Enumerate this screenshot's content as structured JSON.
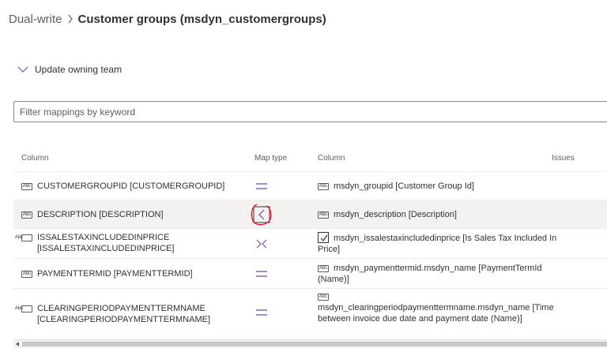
{
  "breadcrumb": {
    "root": "Dual-write",
    "current": "Customer groups (msdyn_customergroups)",
    "separator_icon": "chevron-right-icon"
  },
  "owning_team": {
    "label": "Update owning team",
    "icon": "chevron-down-icon",
    "accent": "#8764b8"
  },
  "filter": {
    "placeholder": "Filter mappings by keyword",
    "value": ""
  },
  "grid": {
    "headers": {
      "source_column": "Column",
      "map_type": "Map type",
      "target_column": "Column",
      "issues": "Issues"
    },
    "rows": [
      {
        "source_icon": "Abc",
        "source": "CUSTOMERGROUPID [CUSTOMERGROUPID]",
        "map_type": "equals-icon",
        "target_icon": "Abc",
        "target": "msdyn_groupid [Customer Group Id]"
      },
      {
        "source_icon": "Abc",
        "source": "DESCRIPTION [DESCRIPTION]",
        "map_type": "chevron-left-icon",
        "target_icon": "Abc",
        "target": "msdyn_description [Description]",
        "selected": true
      },
      {
        "source_icon": "",
        "source": "ISSALESTAXINCLUDEDINPRICE [ISSALESTAXINCLUDEDINPRICE]",
        "map_type": "transform-icon",
        "target_icon": "checkbox-icon",
        "target": "msdyn_issalestaxincludedinprice [Is Sales Tax Included In Price]"
      },
      {
        "source_icon": "Abc",
        "source": "PAYMENTTERMID [PAYMENTTERMID]",
        "map_type": "equals-icon",
        "target_icon": "Abc",
        "target": "msdyn_paymenttermid.msdyn_name [PaymentTermId (Name)]"
      },
      {
        "source_icon": "Abc",
        "source": "CLEARINGPERIODPAYMENTTERMNAME [CLEARINGPERIODPAYMENTTERMNAME]",
        "map_type": "equals-icon",
        "target_icon": "Abc",
        "target": "msdyn_clearingperiodpaymenttermname.msdyn_name [Time between invoice due date and payment date (Name)]"
      }
    ]
  },
  "colors": {
    "map_icon": "#8764b8",
    "annotation": "#e81123",
    "selected_row": "#f3f2f1"
  }
}
